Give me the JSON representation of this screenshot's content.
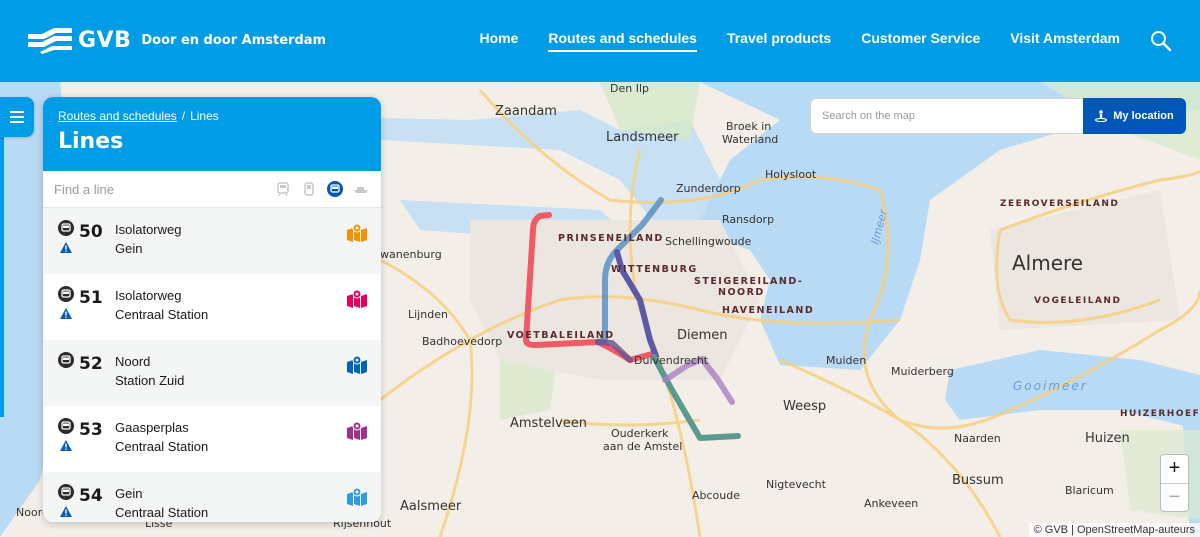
{
  "header": {
    "brand": "GVB",
    "tagline": "Door en door Amsterdam",
    "nav": [
      {
        "label": "Home",
        "active": false
      },
      {
        "label": "Routes and schedules",
        "active": true
      },
      {
        "label": "Travel products",
        "active": false
      },
      {
        "label": "Customer Service",
        "active": false
      },
      {
        "label": "Visit Amsterdam",
        "active": false
      }
    ],
    "search_icon": "search-icon"
  },
  "panel": {
    "breadcrumb": [
      {
        "label": "Routes and schedules",
        "link": true
      },
      {
        "label": "/",
        "link": false
      },
      {
        "label": "Lines",
        "link": false
      }
    ],
    "title": "Lines",
    "find_placeholder": "Find a line",
    "modes": [
      {
        "name": "tram-icon",
        "active": false
      },
      {
        "name": "bus-icon",
        "active": false
      },
      {
        "name": "metro-icon",
        "active": true
      },
      {
        "name": "ferry-icon",
        "active": false
      }
    ],
    "lines": [
      {
        "number": "50",
        "from": "Isolatorweg",
        "to": "Gein",
        "warning": true,
        "color": "#f39200"
      },
      {
        "number": "51",
        "from": "Isolatorweg",
        "to": "Centraal Station",
        "warning": true,
        "color": "#e5005e"
      },
      {
        "number": "52",
        "from": "Noord",
        "to": "Station Zuid",
        "warning": false,
        "color": "#0063be"
      },
      {
        "number": "53",
        "from": "Gaasperplas",
        "to": "Centraal Station",
        "warning": true,
        "color": "#a0308e"
      },
      {
        "number": "54",
        "from": "Gein",
        "to": "Centraal Station",
        "warning": true,
        "color": "#2f9be2"
      }
    ]
  },
  "map": {
    "search_placeholder": "Search on the map",
    "my_location_label": "My location",
    "zoom_in": "+",
    "zoom_out": "−",
    "attribution": "© GVB | OpenStreetMap-auteurs",
    "places": [
      {
        "name": "Zaandam"
      },
      {
        "name": "Den Ilp"
      },
      {
        "name": "Landsmeer"
      },
      {
        "name": "Broek in"
      },
      {
        "name": "Waterland"
      },
      {
        "name": "Holysloot"
      },
      {
        "name": "Zunderdorp"
      },
      {
        "name": "Ransdorp"
      },
      {
        "name": "Schellingwoude"
      },
      {
        "name": "wanenburg"
      },
      {
        "name": "Lijnden"
      },
      {
        "name": "Badhoevedorp"
      },
      {
        "name": "Diemen"
      },
      {
        "name": "Duivendrecht"
      },
      {
        "name": "Muiden"
      },
      {
        "name": "Muiderberg"
      },
      {
        "name": "Weesp"
      },
      {
        "name": "Amstelveen"
      },
      {
        "name": "Ouderkerk"
      },
      {
        "name": "aan de Amstel"
      },
      {
        "name": "Naarden"
      },
      {
        "name": "Huizen"
      },
      {
        "name": "Aalsmeer"
      },
      {
        "name": "Abcoude"
      },
      {
        "name": "Nigtevecht"
      },
      {
        "name": "Bussum"
      },
      {
        "name": "Ankeveen"
      },
      {
        "name": "Blaricum"
      },
      {
        "name": "Almere"
      },
      {
        "name": "Noord"
      },
      {
        "name": "Lisse"
      },
      {
        "name": "Rijsenhout"
      }
    ],
    "districts": [
      {
        "name": "PRINSENEILAND"
      },
      {
        "name": "WITTENBURG"
      },
      {
        "name": "STEIGEREILAND-"
      },
      {
        "name": "NOORD"
      },
      {
        "name": "HAVENEILAND"
      },
      {
        "name": "VOETBALEILAND"
      },
      {
        "name": "ZEEROVERSEILAND"
      },
      {
        "name": "VOGELEILAND"
      },
      {
        "name": "HUIZERHOEF"
      }
    ],
    "water": [
      {
        "name": "IJmeer"
      },
      {
        "name": "Gooimeer"
      }
    ]
  }
}
